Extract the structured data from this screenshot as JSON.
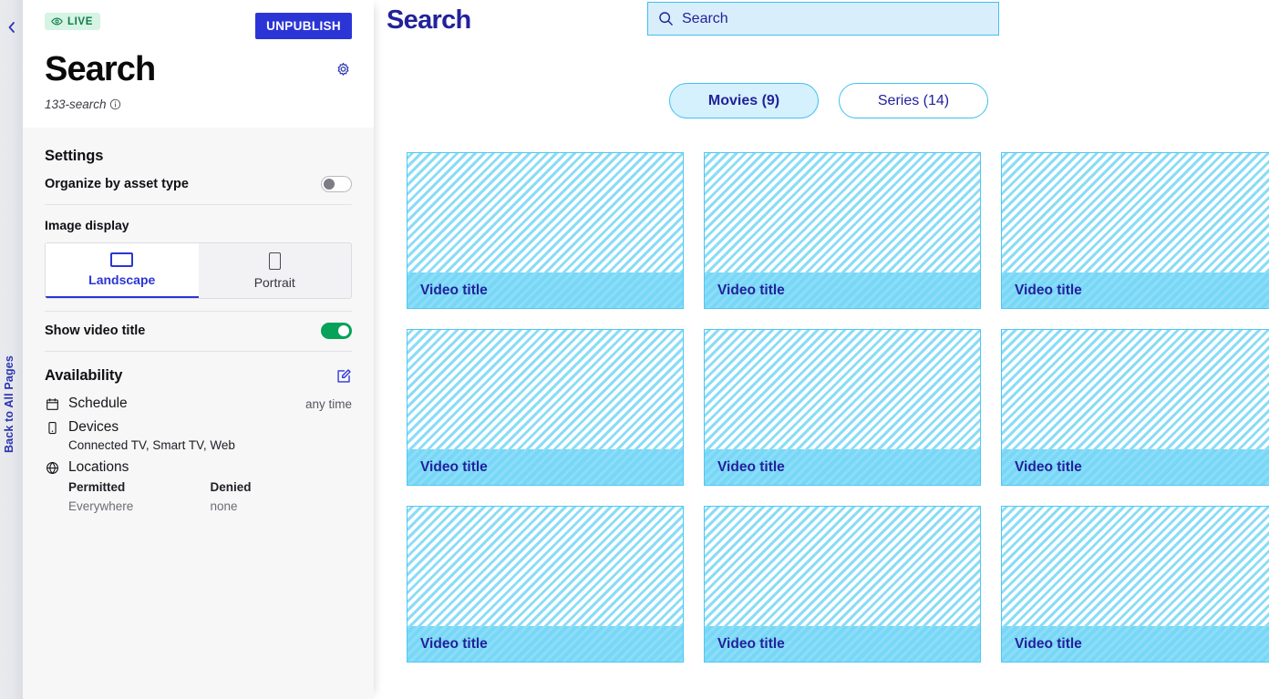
{
  "rail": {
    "back_label": "Back to All Pages",
    "collapse_icon": "chevron-left-icon"
  },
  "panel": {
    "status_badge": {
      "label": "LIVE",
      "icon": "eye-icon",
      "bg": "#d5f4e3",
      "fg": "#137a4b"
    },
    "unpublish_label": "UNPUBLISH",
    "title": "Search",
    "slug": "133-search",
    "slug_info_icon": "info-circle-icon",
    "settings_icon": "gear-icon",
    "settings": {
      "heading": "Settings",
      "organize_label": "Organize by asset type",
      "organize_on": false,
      "image_display_label": "Image display",
      "image_display_options": [
        "Landscape",
        "Portrait"
      ],
      "image_display_selected": "Landscape",
      "show_video_title_label": "Show video title",
      "show_video_title_on": true
    },
    "availability": {
      "heading": "Availability",
      "edit_icon": "edit-pencil-icon",
      "schedule_label": "Schedule",
      "schedule_value": "any time",
      "devices_label": "Devices",
      "devices_value": "Connected TV, Smart TV, Web",
      "locations_label": "Locations",
      "permitted_header": "Permitted",
      "permitted_value": "Everywhere",
      "denied_header": "Denied",
      "denied_value": "none"
    }
  },
  "preview": {
    "title": "Search",
    "search": {
      "placeholder": "Search",
      "value": "",
      "icon": "search-icon"
    },
    "filters": [
      {
        "label": "Movies (9)",
        "active": true
      },
      {
        "label": "Series (14)",
        "active": false
      }
    ],
    "cards": [
      {
        "title": "Video title"
      },
      {
        "title": "Video title"
      },
      {
        "title": "Video title"
      },
      {
        "title": "Video title"
      },
      {
        "title": "Video title"
      },
      {
        "title": "Video title"
      },
      {
        "title": "Video title"
      },
      {
        "title": "Video title"
      },
      {
        "title": "Video title"
      }
    ]
  },
  "colors": {
    "brand_blue": "#2b35d6",
    "preview_navy": "#22229b",
    "accent_cyan": "#3fc0f0",
    "toggle_green": "#06a259"
  }
}
